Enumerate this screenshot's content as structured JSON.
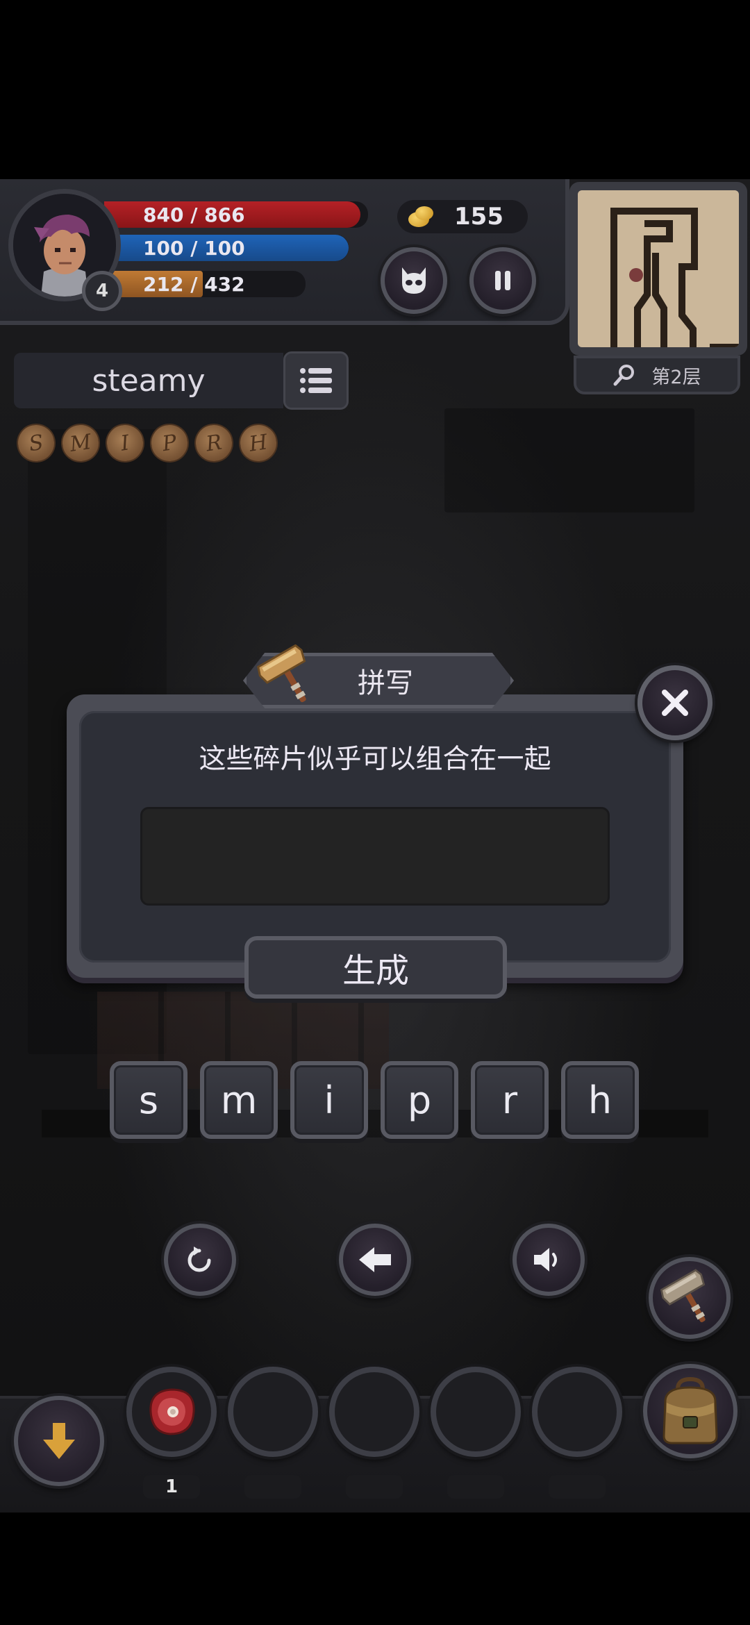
{
  "player": {
    "hp": "840 / 866",
    "hp_fraction": 0.97,
    "mp": "100 / 100",
    "mp_fraction": 1.0,
    "xp_current": "212",
    "xp_sep": " / 432",
    "xp_fraction": 0.49,
    "level": "4"
  },
  "currency": {
    "gold": "155"
  },
  "minimap": {
    "floor_label": "第2层"
  },
  "word_panel": {
    "word": "steamy",
    "runes": [
      "S",
      "M",
      "I",
      "P",
      "R",
      "H"
    ]
  },
  "dialog": {
    "title": "拼写",
    "message": "这些碎片似乎可以组合在一起",
    "input_value": "",
    "generate_label": "生成"
  },
  "letters": [
    "s",
    "m",
    "i",
    "p",
    "r",
    "h"
  ],
  "inventory": {
    "slots": [
      {
        "item": "meat-icon",
        "count": "1"
      },
      {
        "item": "",
        "count": ""
      },
      {
        "item": "",
        "count": ""
      },
      {
        "item": "",
        "count": ""
      },
      {
        "item": "",
        "count": ""
      }
    ]
  },
  "colors": {
    "hp_bar": "#b52126",
    "mp_bar": "#1f64b8",
    "xp_bar": "#c07a34",
    "panel": "#2d2f37",
    "accent_gold": "#e0b24a"
  }
}
